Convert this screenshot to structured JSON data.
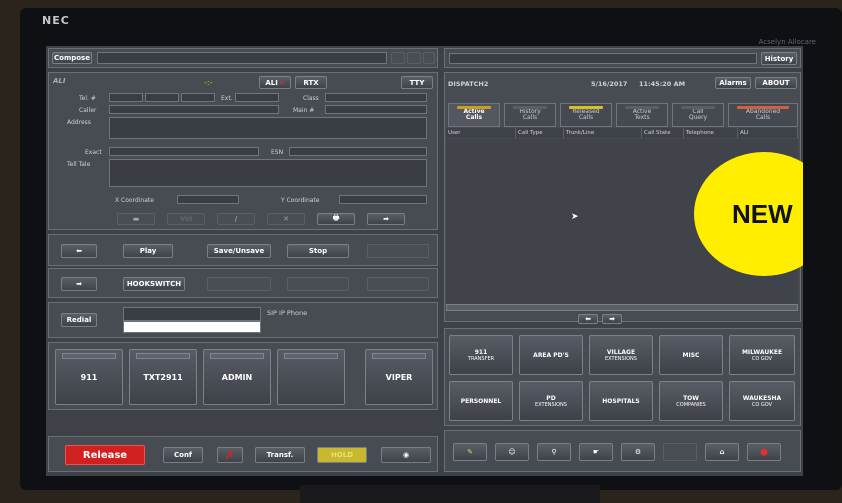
{
  "device": {
    "brand": "NEC",
    "vendor": "Acselyn Allocare"
  },
  "compose": {
    "label": "Compose"
  },
  "ali": {
    "title": "ALI",
    "ali_button": "ALI",
    "rtx_button": "RTX",
    "tty_button": "TTY",
    "labels": {
      "tel": "Tel. #",
      "ext": "Ext.",
      "class": "Class",
      "caller": "Caller",
      "main": "Main #",
      "address": "Address",
      "exact": "Exact",
      "esn": "ESN",
      "tell_tale": "Tell Tale",
      "x_coord": "X Coordinate",
      "y_coord": "Y Coordinate"
    }
  },
  "controls": {
    "play": "Play",
    "save_unsave": "Save/Unsave",
    "stop": "Stop",
    "hookswitch": "HOOKSWITCH",
    "redial": "Redial",
    "sip_phone": "SIP IP Phone",
    "vol": "Vol"
  },
  "lines": [
    "911",
    "TXT2911",
    "ADMIN",
    "",
    "VIPER"
  ],
  "bottom": {
    "release": "Release",
    "conf": "Conf",
    "transf": "Transf.",
    "hold": "HOLD"
  },
  "dispatch": {
    "position": "DISPATCH2",
    "date": "5/16/2017",
    "time": "11:45:20 AM",
    "alarms": "Alarms",
    "about": "ABOUT",
    "history": "History"
  },
  "tabs": [
    {
      "line1": "Active",
      "line2": "Calls",
      "bar": "#c8a020"
    },
    {
      "line1": "History",
      "line2": "Calls",
      "bar": "#5a5e66"
    },
    {
      "line1": "Released",
      "line2": "Calls",
      "bar": "#d8c020"
    },
    {
      "line1": "Active",
      "line2": "Texts",
      "bar": "#5a5e66"
    },
    {
      "line1": "Call",
      "line2": "Query",
      "bar": "#5a5e66"
    },
    {
      "line1": "Abandoned",
      "line2": "Calls",
      "bar": "#d06040"
    }
  ],
  "columns": [
    "User",
    "Call Type",
    "Trunk/Line",
    "Call State",
    "Telephone",
    "ALI"
  ],
  "speed_dial": [
    {
      "line1": "911",
      "line2": "TRANSFER"
    },
    {
      "line1": "AREA PD'S",
      "line2": ""
    },
    {
      "line1": "VILLAGE",
      "line2": "EXTENSIONS"
    },
    {
      "line1": "MISC",
      "line2": ""
    },
    {
      "line1": "MILWAUKEE",
      "line2": "CO GOV"
    },
    {
      "line1": "PERSONNEL",
      "line2": ""
    },
    {
      "line1": "PD",
      "line2": "EXTENSIONS"
    },
    {
      "line1": "HOSPITALS",
      "line2": ""
    },
    {
      "line1": "TOW",
      "line2": "COMPANIES"
    },
    {
      "line1": "WAUKESHA",
      "line2": "CO GOV"
    }
  ],
  "badge": {
    "text": "NEW",
    "color": "#ffee00"
  }
}
